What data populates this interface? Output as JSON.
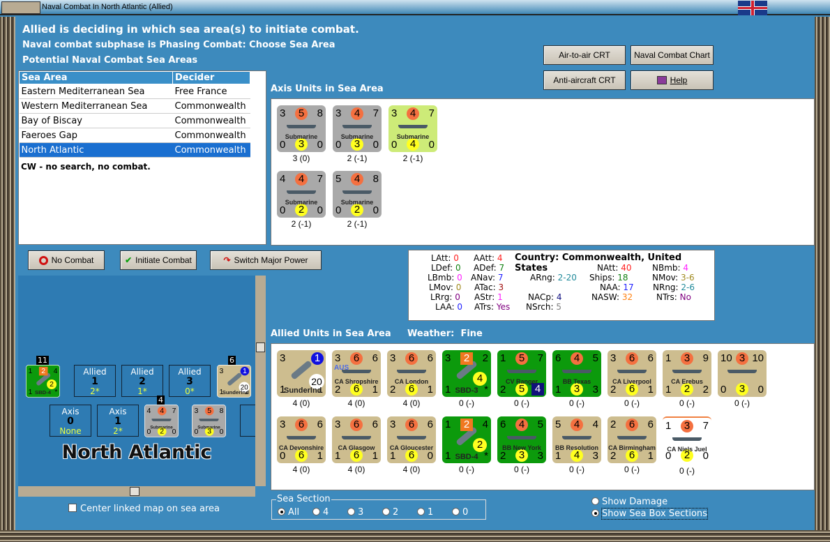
{
  "window": {
    "title": "Naval Combat In North Atlantic (Allied)"
  },
  "header": {
    "line1": "Allied is deciding in which sea area(s) to initiate combat.",
    "line2": "Naval combat subphase is Phasing Combat: Choose Sea Area",
    "line3": "Potential Naval Combat Sea Areas"
  },
  "buttons": {
    "air_to_air": "Air-to-air CRT",
    "naval_chart": "Naval Combat Chart",
    "anti_aircraft": "Anti-aircraft CRT",
    "help": "Help",
    "no_combat": "No Combat",
    "initiate": "Initiate Combat",
    "switch": "Switch Major Power"
  },
  "sea_table": {
    "headers": [
      "Sea Area",
      "Decider"
    ],
    "rows": [
      [
        "Eastern Mediterranean Sea",
        "Free France"
      ],
      [
        "Western Mediterranean Sea",
        "Commonwealth"
      ],
      [
        "Bay of Biscay",
        "Commonwealth"
      ],
      [
        "Faeroes Gap",
        "Commonwealth"
      ],
      [
        "North Atlantic",
        "Commonwealth"
      ]
    ],
    "selected": 4,
    "note": "CW - no search, no combat."
  },
  "axis_title": "Axis Units in Sea Area",
  "allied_title": "Allied Units in Sea Area",
  "weather_label": "Weather:",
  "weather": "Fine",
  "axis_units": [
    {
      "tl": "3",
      "tc": "5",
      "tr": "8",
      "name": "Submarine",
      "bl": "0",
      "bc": "3",
      "br": "0",
      "cap": "3 (0)",
      "bg": "#a9a9a9",
      "kind": "ship"
    },
    {
      "tl": "3",
      "tc": "4",
      "tr": "7",
      "name": "Submarine",
      "bl": "0",
      "bc": "3",
      "br": "0",
      "cap": "2 (-1)",
      "bg": "#a9a9a9",
      "kind": "ship"
    },
    {
      "tl": "3",
      "tc": "4",
      "tr": "7",
      "name": "Submarine",
      "bl": "0",
      "bc": "4",
      "br": "0",
      "cap": "2 (-1)",
      "bg": "#cdeb78",
      "kind": "ship"
    },
    {
      "tl": "4",
      "tc": "4",
      "tr": "7",
      "name": "Submarine",
      "bl": "0",
      "bc": "2",
      "br": "0",
      "cap": "2 (-1)",
      "bg": "#a9a9a9",
      "kind": "ship"
    },
    {
      "tl": "5",
      "tc": "4",
      "tr": "8",
      "name": "Submarine",
      "bl": "0",
      "bc": "2",
      "br": "0",
      "cap": "2 (-1)",
      "bg": "#a9a9a9",
      "kind": "ship"
    }
  ],
  "allied_units": [
    {
      "tl": "3",
      "tc": "1",
      "tcStyle": "blue",
      "tr": "",
      "name": "Sunderlnd",
      "bl": "1",
      "bc": "",
      "br": "1",
      "extra": "20",
      "cap": "4 (0)",
      "bg": "#cdbd8f",
      "kind": "plane"
    },
    {
      "tl": "3",
      "tc": "6",
      "tr": "6",
      "name": "CA Shropshire",
      "bl": "2",
      "bc": "6",
      "br": "1",
      "flag": "AUS",
      "cap": "4 (0)",
      "bg": "#cdbd8f",
      "kind": "ship"
    },
    {
      "tl": "3",
      "tc": "6",
      "tr": "6",
      "name": "CA London",
      "bl": "2",
      "bc": "6",
      "br": "1",
      "cap": "4 (0)",
      "bg": "#cdbd8f",
      "kind": "ship"
    },
    {
      "tl": "3",
      "tc": "2",
      "tcStyle": "sq",
      "tr": "2",
      "name": "SBD-3",
      "bl": "1",
      "bc": "4",
      "bcStyle": "air",
      "br": "*",
      "cap": "0 (-)",
      "bg": "#0c9a0c",
      "kind": "plane"
    },
    {
      "tl": "1",
      "tc": "5",
      "tr": "7",
      "name": "CV Ranger",
      "bl": "2",
      "bc": "5",
      "br": "4",
      "brStyle": "navy",
      "cap": "0 (-)",
      "bg": "#0c9a0c",
      "kind": "ship"
    },
    {
      "tl": "6",
      "tc": "4",
      "tr": "5",
      "name": "BB Texas",
      "bl": "1",
      "bc": "3",
      "br": "3",
      "cap": "0 (-)",
      "bg": "#0c9a0c",
      "kind": "ship"
    },
    {
      "tl": "3",
      "tc": "6",
      "tr": "6",
      "name": "CA Liverpool",
      "bl": "2",
      "bc": "6",
      "br": "1",
      "cap": "0 (-)",
      "bg": "#cdbd8f",
      "kind": "ship"
    },
    {
      "tl": "1",
      "tc": "3",
      "tr": "9",
      "name": "CA Erebus",
      "bl": "1",
      "bc": "2",
      "br": "2",
      "cap": "0 (-)",
      "bg": "#cdbd8f",
      "kind": "ship"
    },
    {
      "tl": "10",
      "tc": "3",
      "tr": "10",
      "name": "",
      "bl": "0",
      "bc": "3",
      "br": "0",
      "cap": "0 (-)",
      "bg": "#cdbd8f",
      "kind": "ship"
    },
    {
      "tl": "3",
      "tc": "6",
      "tr": "6",
      "name": "CA Devonshire",
      "bl": "0",
      "bc": "6",
      "br": "1",
      "cap": "4 (0)",
      "bg": "#cdbd8f",
      "kind": "ship"
    },
    {
      "tl": "3",
      "tc": "6",
      "tr": "6",
      "name": "CA Glasgow",
      "bl": "1",
      "bc": "6",
      "br": "1",
      "cap": "4 (0)",
      "bg": "#cdbd8f",
      "kind": "ship"
    },
    {
      "tl": "3",
      "tc": "6",
      "tr": "6",
      "name": "CA Gloucester",
      "bl": "1",
      "bc": "6",
      "br": "0",
      "cap": "4 (0)",
      "bg": "#cdbd8f",
      "kind": "ship"
    },
    {
      "tl": "1",
      "tc": "2",
      "tcStyle": "sq",
      "tr": "4",
      "name": "SBD-4",
      "bl": "1",
      "bc": "2",
      "bcStyle": "air",
      "br": "*",
      "cap": "0 (-)",
      "bg": "#0c9a0c",
      "kind": "plane"
    },
    {
      "tl": "6",
      "tc": "4",
      "tr": "5",
      "name": "BB New York",
      "bl": "2",
      "bc": "3",
      "br": "3",
      "cap": "0 (-)",
      "bg": "#0c9a0c",
      "kind": "ship"
    },
    {
      "tl": "5",
      "tc": "4",
      "tr": "4",
      "name": "BB Resolution",
      "bl": "1",
      "bc": "4",
      "br": "3",
      "cap": "0 (-)",
      "bg": "#cdbd8f",
      "kind": "ship"
    },
    {
      "tl": "2",
      "tc": "6",
      "tr": "6",
      "name": "CA Birmingham",
      "bl": "2",
      "bc": "6",
      "br": "1",
      "cap": "0 (-)",
      "bg": "#cdbd8f",
      "kind": "ship"
    },
    {
      "tl": "1",
      "tc": "3",
      "tr": "7",
      "name": "CA Niels Juel",
      "bl": "0",
      "bc": "2",
      "br": "0",
      "cap": "0 (-)",
      "bg": "#ffffff",
      "kind": "ship"
    }
  ],
  "stats": {
    "country_label": "Country:",
    "country": "Commonwealth, United States",
    "items": [
      {
        "k": "LAtt:",
        "v": "0",
        "c": "#ff2020"
      },
      {
        "k": "LDef:",
        "v": "0",
        "c": "#108010"
      },
      {
        "k": "LBmb:",
        "v": "0",
        "c": "#ff20ff"
      },
      {
        "k": "LMov:",
        "v": "0",
        "c": "#a08a20"
      },
      {
        "k": "LRrg:",
        "v": "0",
        "c": "#800080"
      },
      {
        "k": "LAA:",
        "v": "0",
        "c": "#2020ff"
      },
      {
        "k": "AAtt:",
        "v": "4",
        "c": "#ff2020"
      },
      {
        "k": "ADef:",
        "v": "7",
        "c": "#108010"
      },
      {
        "k": "ANav:",
        "v": "7",
        "c": "#2020ff"
      },
      {
        "k": "ATac:",
        "v": "3",
        "c": "#a01010"
      },
      {
        "k": "AStr:",
        "v": "1",
        "c": "#ff20ff"
      },
      {
        "k": "ATrs:",
        "v": "Yes",
        "c": "#800080"
      },
      {
        "k": "ARng:",
        "v": "2-20",
        "c": "#208a9a"
      },
      {
        "k": "NACp:",
        "v": "4",
        "c": "#101080"
      },
      {
        "k": "NSrch:",
        "v": "5",
        "c": "#808080"
      },
      {
        "k": "NAtt:",
        "v": "40",
        "c": "#ff2020"
      },
      {
        "k": "Ships:",
        "v": "18",
        "c": "#108010"
      },
      {
        "k": "NAA:",
        "v": "17",
        "c": "#2020ff"
      },
      {
        "k": "NASW:",
        "v": "32",
        "c": "#ff8010"
      },
      {
        "k": "NBmb:",
        "v": "4",
        "c": "#ff20ff"
      },
      {
        "k": "NMov:",
        "v": "3-6",
        "c": "#a08a20"
      },
      {
        "k": "NRng:",
        "v": "2-6",
        "c": "#208a9a"
      },
      {
        "k": "NTrs:",
        "v": "No",
        "c": "#800080"
      }
    ]
  },
  "map": {
    "title": "North Atlantic",
    "allied_boxes": [
      {
        "label": "Allied",
        "num": "1",
        "val": "2*"
      },
      {
        "label": "Allied",
        "num": "2",
        "val": "1*"
      },
      {
        "label": "Allied",
        "num": "3",
        "val": "0*"
      }
    ],
    "axis_boxes": [
      {
        "label": "Axis",
        "num": "0",
        "val": "None"
      },
      {
        "label": "Axis",
        "num": "1",
        "val": "2*"
      },
      {
        "label": "Ax",
        "num": "",
        "val": ""
      }
    ],
    "stack_counts": [
      "11",
      "6",
      "4"
    ],
    "units": [
      {
        "tl": "1",
        "tc": "2",
        "tcStyle": "sq",
        "tr": "4",
        "name": "SBD-4",
        "bl": "1",
        "bc": "2",
        "bcStyle": "air",
        "br": "*",
        "bg": "#0c9a0c",
        "kind": "plane"
      },
      {
        "tl": "3",
        "tc": "1",
        "tcStyle": "blue",
        "tr": "",
        "name": "Sunderlnd",
        "bl": "1",
        "bc": "",
        "br": "1",
        "extra": "20",
        "bg": "#cdbd8f",
        "kind": "plane"
      },
      {
        "tl": "4",
        "tc": "4",
        "tr": "7",
        "name": "Submarine",
        "bl": "0",
        "bc": "2",
        "br": "0",
        "bg": "#a9a9a9",
        "kind": "ship"
      },
      {
        "tl": "3",
        "tc": "5",
        "tr": "8",
        "name": "Submarine",
        "bl": "0",
        "bc": "3",
        "br": "0",
        "bg": "#a9a9a9",
        "kind": "ship"
      }
    ]
  },
  "center_map_label": "Center linked map on sea area",
  "sea_section": {
    "legend": "Sea Section",
    "options": [
      "All",
      "4",
      "3",
      "2",
      "1",
      "0"
    ],
    "selected": 0
  },
  "display": {
    "options": [
      "Show Damage",
      "Show Sea Box Sections"
    ],
    "selected": 1
  }
}
